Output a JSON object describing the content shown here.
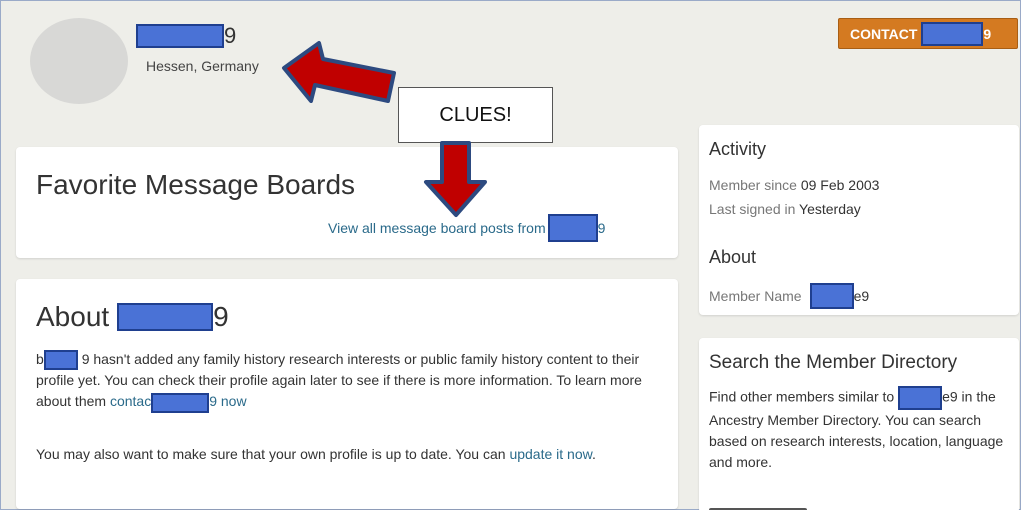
{
  "profile": {
    "username_suffix": "9",
    "location": "Hessen, Germany"
  },
  "header": {
    "contact_label": "CONTACT",
    "contact_suffix": "9"
  },
  "annotation": {
    "callout_text": "CLUES!"
  },
  "favorites": {
    "title": "Favorite Message Boards",
    "link_prefix": "View all message board posts from",
    "link_suffix": "9"
  },
  "about_card": {
    "title_prefix": "About",
    "title_suffix": "9",
    "p1_lead": "b",
    "p1_main": "9 hasn't added any family history research interests or public family history content to their profile yet. You can check their profile again later to see if there is more information. To learn more about them",
    "p1_link": "contac",
    "p1_link_suffix": "9 now",
    "p2_text": "You may also want to make sure that your own profile is up to date. You can",
    "p2_link": "update it now",
    "p2_end": "."
  },
  "activity": {
    "title": "Activity",
    "member_since_label": "Member since",
    "member_since_value": "09 Feb 2003",
    "last_signed_label": "Last signed in",
    "last_signed_value": "Yesterday",
    "about_title": "About",
    "member_name_label": "Member Name",
    "member_name_suffix": "e9"
  },
  "search": {
    "title": "Search the Member Directory",
    "text_prefix": "Find other members similar to",
    "text_suffix": "e9",
    "text_rest": "in the Ancestry Member Directory. You can search based on research interests, location, language and more."
  },
  "colors": {
    "accent": "#d47a21",
    "link": "#2a6a8a",
    "redaction": "#4a72d6",
    "arrow": "#c00000"
  }
}
